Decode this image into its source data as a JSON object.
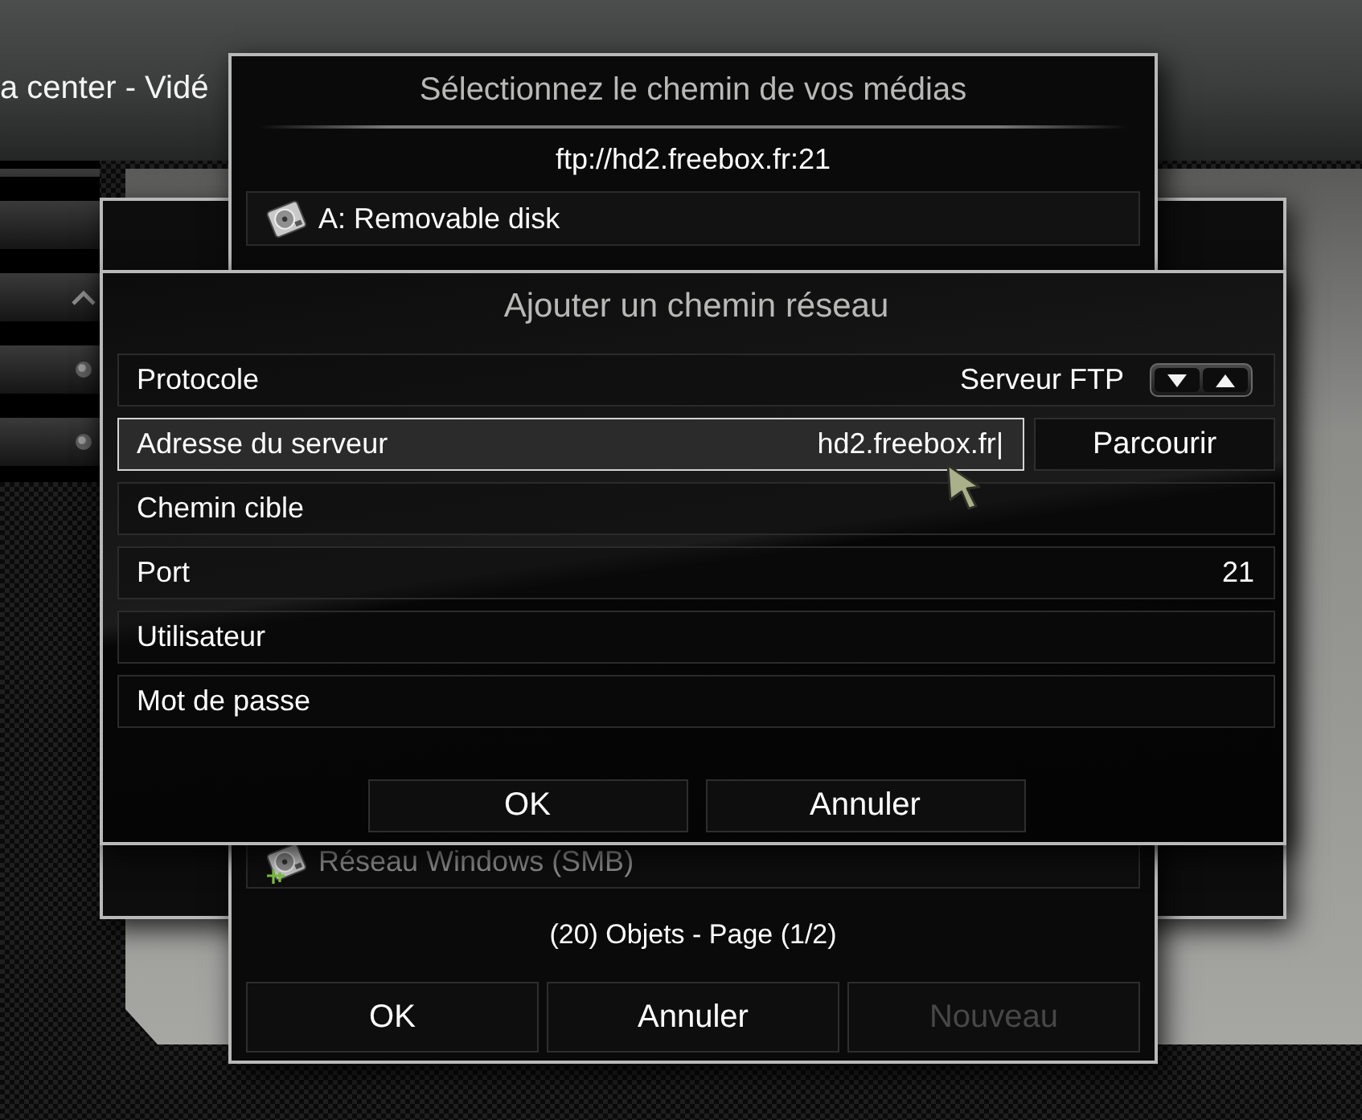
{
  "background": {
    "title": "a center - Vidé"
  },
  "media_dialog": {
    "title": "Sélectionnez le chemin de vos médias",
    "path": "ftp://hd2.freebox.fr:21",
    "items": [
      {
        "label": "A: Removable disk",
        "kind": "disk",
        "dimmed": false
      },
      {
        "label": "Réseau Windows (SMB)",
        "kind": "network",
        "dimmed": true
      }
    ],
    "status": "(20) Objets - Page (1/2)",
    "buttons": [
      {
        "label": "OK",
        "disabled": false
      },
      {
        "label": "Annuler",
        "disabled": false
      },
      {
        "label": "Nouveau",
        "disabled": true
      }
    ]
  },
  "network_dialog": {
    "title": "Ajouter un chemin réseau",
    "fields": [
      {
        "label": "Protocole",
        "value": "Serveur FTP",
        "kind": "spinner",
        "selected": false
      },
      {
        "label": "Adresse du serveur",
        "value": "hd2.freebox.fr|",
        "kind": "text",
        "selected": true,
        "action": "Parcourir"
      },
      {
        "label": "Chemin cible",
        "kind": "text",
        "selected": false
      },
      {
        "label": "Port",
        "value": "21",
        "kind": "text",
        "selected": false
      },
      {
        "label": "Utilisateur",
        "kind": "text",
        "selected": false
      },
      {
        "label": "Mot de passe",
        "kind": "text",
        "selected": false
      }
    ],
    "buttons": [
      {
        "label": "OK"
      },
      {
        "label": "Annuler"
      }
    ]
  }
}
